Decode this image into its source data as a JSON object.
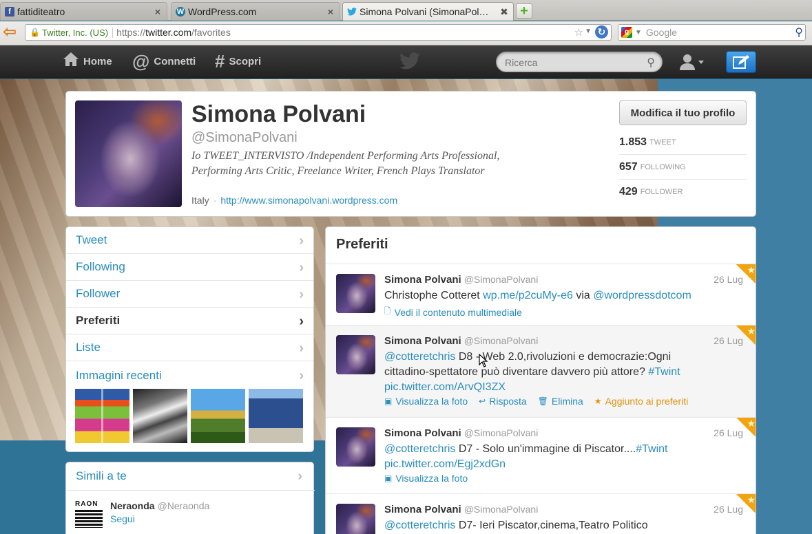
{
  "browser": {
    "tabs": [
      {
        "title": "fattiditeatro",
        "favicon": "f"
      },
      {
        "title": "WordPress.com",
        "favicon": "W"
      },
      {
        "title": "Simona Polvani (SimonaPol…",
        "favicon": "t"
      }
    ],
    "new_tab_label": "+",
    "identity": "Twitter, Inc. (US)",
    "url_scheme": "https://",
    "url_host": "twitter.com",
    "url_path": "/favorites",
    "search_placeholder": "Google"
  },
  "topbar": {
    "nav": [
      {
        "label": "Home",
        "icon": "home-icon"
      },
      {
        "label": "Connetti",
        "icon": "at-icon"
      },
      {
        "label": "Scopri",
        "icon": "hash-icon"
      }
    ],
    "search_placeholder": "Ricerca"
  },
  "profile": {
    "name": "Simona Polvani",
    "handle": "@SimonaPolvani",
    "bio": "Io TWEET_INTERVISTO /Independent Performing Arts Professional, Performing Arts Critic, Freelance Writer, French Plays Translator",
    "location": "Italy",
    "separator": "·",
    "website": "http://www.simonapolvani.wordpress.com",
    "edit_button": "Modifica il tuo profilo",
    "stats": [
      {
        "value": "1.853",
        "label": "TWEET"
      },
      {
        "value": "657",
        "label": "FOLLOWING"
      },
      {
        "value": "429",
        "label": "FOLLOWER"
      }
    ]
  },
  "sidebar": {
    "items": [
      {
        "label": "Tweet"
      },
      {
        "label": "Following"
      },
      {
        "label": "Follower"
      },
      {
        "label": "Preferiti",
        "selected": true
      },
      {
        "label": "Liste"
      },
      {
        "label": "Immagini recenti"
      }
    ],
    "similar": {
      "title": "Simili a te",
      "user_avatar_text": "RAON",
      "user_name": "Neraonda",
      "user_handle": "@Neraonda",
      "follow_label": "Segui"
    }
  },
  "timeline": {
    "title": "Preferiti",
    "tweets": [
      {
        "name": "Simona Polvani",
        "handle": "@SimonaPolvani",
        "date": "26 Lug",
        "text_plain": "Christophe Cotteret ",
        "link1": "wp.me/p2cuMy-e6",
        "text_mid": " via ",
        "link2": "@wordpressdotcom",
        "action_media": "Vedi il contenuto multimediale"
      },
      {
        "name": "Simona Polvani",
        "handle": "@SimonaPolvani",
        "date": "26 Lug",
        "mention": "@cotteretchris",
        "text": " D8 - Web 2.0,rivoluzioni e democrazie:Ogni cittadino-spettatore può diventare davvero più attore? ",
        "hashtag": "#Twint",
        "pic": "pic.twitter.com/ArvQI3ZX",
        "actions": {
          "photo": "Visualizza la foto",
          "reply": "Risposta",
          "delete": "Elimina",
          "faved": "Aggiunto ai preferiti"
        }
      },
      {
        "name": "Simona Polvani",
        "handle": "@SimonaPolvani",
        "date": "26 Lug",
        "mention": "@cotteretchris",
        "text": " D7 - Solo un'immagine di Piscator....",
        "hashtag": "#Twint",
        "pic": "pic.twitter.com/Egj2xdGn",
        "action_photo": "Visualizza la foto"
      },
      {
        "name": "Simona Polvani",
        "handle": "@SimonaPolvani",
        "date": "26 Lug",
        "mention": "@cotteretchris",
        "text": " D7- Ieri Piscator,cinema,Teatro Politico"
      }
    ]
  },
  "colors": {
    "link": "#2a8dbe",
    "fav_orange": "#f2a311",
    "topbar": "#2b2b2b",
    "compose_blue": "#2a87d6"
  }
}
